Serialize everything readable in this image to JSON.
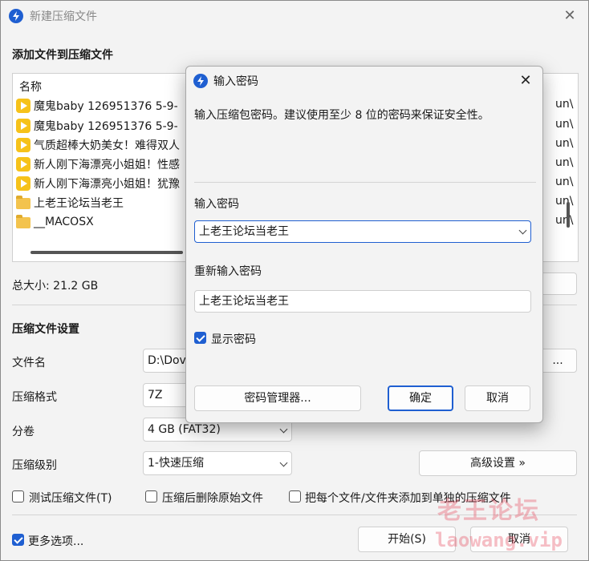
{
  "main_window": {
    "title": "新建压缩文件",
    "add_files_heading": "添加文件到压缩文件",
    "file_list": {
      "header": "名称",
      "rows": [
        {
          "type": "video",
          "name": "魔鬼baby 126951376  5-9-",
          "right": "un\\"
        },
        {
          "type": "video",
          "name": "魔鬼baby 126951376  5-9-",
          "right": "un\\"
        },
        {
          "type": "video",
          "name": "气质超棒大奶美女！难得双人",
          "right": "un\\"
        },
        {
          "type": "video",
          "name": "新人刚下海漂亮小姐姐！性感",
          "right": "un\\"
        },
        {
          "type": "video",
          "name": "新人刚下海漂亮小姐姐！犹豫",
          "right": "un\\"
        },
        {
          "type": "folder",
          "name": "上老王论坛当老王",
          "right": "un\\"
        },
        {
          "type": "folder",
          "name": "__MACOSX",
          "right": "un\\"
        }
      ]
    },
    "total_size": "总大小: 21.2 GB",
    "settings_heading": "压缩文件设置",
    "filename_label": "文件名",
    "filename_value": "D:\\Dov",
    "browse_label": "...",
    "format_label": "压缩格式",
    "format_value": "7Z",
    "volume_label": "分卷",
    "volume_value": "4 GB (FAT32)",
    "level_label": "压缩级别",
    "level_value": "1-快速压缩",
    "advanced_button": "高级设置 »",
    "test_checkbox": "测试压缩文件(T)",
    "delete_checkbox": "压缩后删除原始文件",
    "separate_checkbox": "把每个文件/文件夹添加到单独的压缩文件",
    "more_options": "更多选项...",
    "start_button": "开始(S)",
    "cancel_button": "取消"
  },
  "password_dialog": {
    "title": "输入密码",
    "description": "输入压缩包密码。建议使用至少 8 位的密码来保证安全性。",
    "password_label": "输入密码",
    "password_value": "上老王论坛当老王",
    "confirm_label": "重新输入密码",
    "confirm_value": "上老王论坛当老王",
    "show_password": "显示密码",
    "manager_button": "密码管理器...",
    "ok_button": "确定",
    "cancel_button": "取消"
  },
  "watermark": {
    "line1": "老王论坛",
    "line2": "laowang.vip"
  },
  "colors": {
    "accent": "#1f5fd1",
    "window_bg": "#f3f3f3",
    "watermark": "#e6465a"
  }
}
